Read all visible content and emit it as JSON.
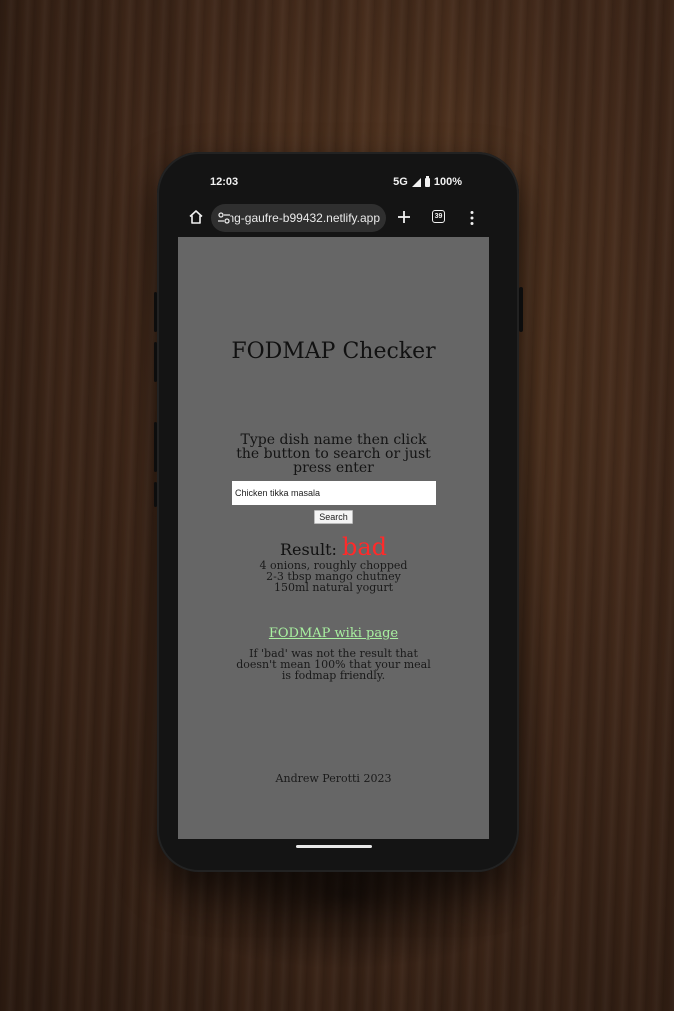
{
  "status_bar": {
    "time": "12:03",
    "network": "5G",
    "battery": "100%"
  },
  "browser": {
    "url": "ming-gaufre-b99432.netlify.app",
    "tab_count": "39"
  },
  "page": {
    "title": "FODMAP Checker",
    "instructions": "Type dish name then click the button to search or just press enter",
    "search_value": "Chicken tikka masala",
    "search_button_label": "Search",
    "result_label": "Result:",
    "result_value": "bad",
    "result_color": "#ff2a2a",
    "ingredients": [
      "4 onions, roughly chopped",
      "2-3 tbsp mango chutney",
      "150ml natural yogurt"
    ],
    "wiki_link_label": "FODMAP wiki page",
    "link_color": "#a8f0a0",
    "disclaimer": "If 'bad' was not the result that doesn't mean 100% that your meal is fodmap friendly.",
    "footer": "Andrew Perotti 2023",
    "background_color": "#666666"
  }
}
